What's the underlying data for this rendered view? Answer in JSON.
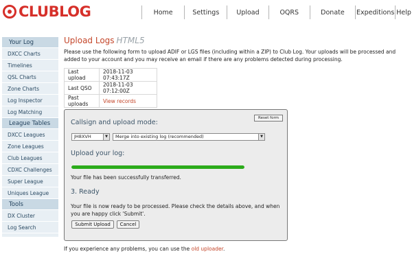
{
  "header": {
    "logo_text": "CLUBLOG",
    "nav": [
      "Home",
      "Settings",
      "Upload",
      "OQRS",
      "Donate",
      "Expeditions",
      "Help"
    ]
  },
  "sidebar": {
    "sections": [
      {
        "title": "Your Log",
        "items": [
          "DXCC Charts",
          "Timelines",
          "QSL Charts",
          "Zone Charts",
          "Log Inspector",
          "Log Matching"
        ]
      },
      {
        "title": "League Tables",
        "items": [
          "DXCC Leagues",
          "Zone Leagues",
          "Club Leagues",
          "CDXC Challenges",
          "Super League",
          "Uniques League"
        ]
      },
      {
        "title": "Tools",
        "items": [
          "DX Cluster",
          "Log Search"
        ]
      }
    ]
  },
  "main": {
    "title": "Upload Logs",
    "title_tag": "HTML5",
    "intro": "Please use the following form to upload ADIF or LGS files (including within a ZIP) to Club Log. Your uploads will be processed and added to your account and you may receive an email if there are any problems detected during processing.",
    "info": {
      "last_upload_label": "Last upload",
      "last_upload_value": "2018-11-03 07:43:17Z",
      "last_qso_label": "Last QSO",
      "last_qso_value": "2018-11-03 07:12:00Z",
      "past_uploads_label": "Past uploads",
      "past_uploads_link": "View records"
    },
    "panel": {
      "heading_callsign": "Callsign and upload mode:",
      "reset_label": "Reset form",
      "callsign_value": "JH8XVH",
      "mode_value": "Merge into existing log (recommended)",
      "heading_upload": "Upload your log:",
      "progress_fraction": 1.0,
      "progress_color": "#2bab1a",
      "transfer_status": "Your file has been successfully transferred.",
      "heading_ready": "3. Ready",
      "ready_text": "Your file is now ready to be processed. Please check the details above, and when you are happy click 'Submit'.",
      "submit_label": "Submit Upload",
      "cancel_label": "Cancel"
    },
    "footer_prefix": "If you experience any problems, you can use the ",
    "footer_link": "old uploader",
    "footer_suffix": "."
  },
  "colors": {
    "brand": "#d6302a",
    "link": "#c4462a",
    "sidebar_header": "#c9d9e4",
    "sidebar_item": "#e8eff4"
  }
}
